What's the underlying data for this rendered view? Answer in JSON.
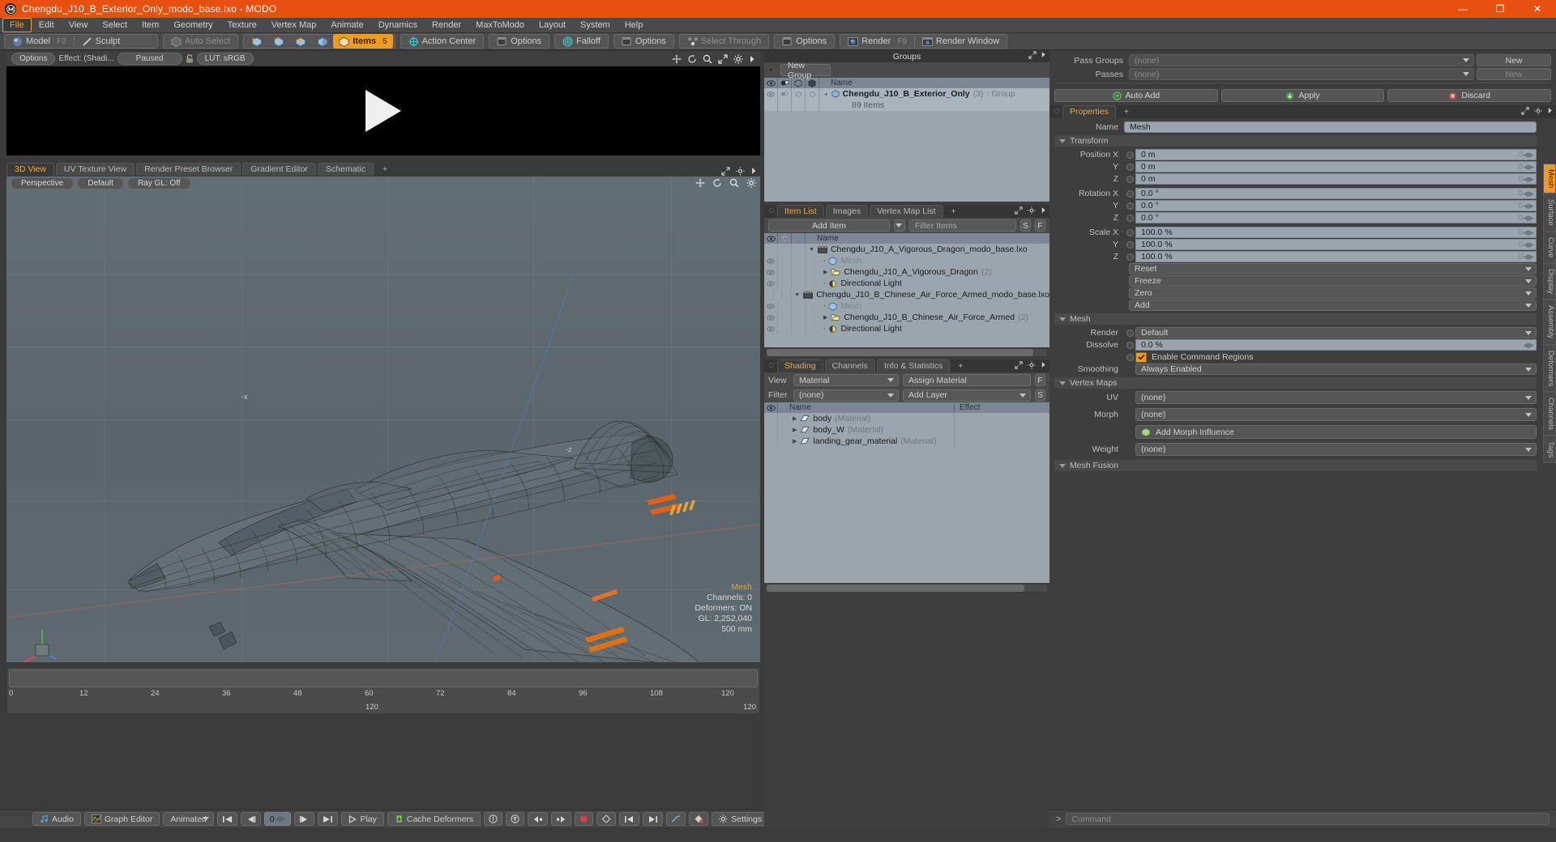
{
  "titlebar": {
    "title": "Chengdu_J10_B_Exterior_Only_modo_base.lxo - MODO",
    "minimize": "—",
    "maximize": "❐",
    "close": "✕"
  },
  "menubar": {
    "items": [
      "File",
      "Edit",
      "View",
      "Select",
      "Item",
      "Geometry",
      "Texture",
      "Vertex Map",
      "Animate",
      "Dynamics",
      "Render",
      "MaxToModo",
      "Layout",
      "System",
      "Help"
    ],
    "active": "File"
  },
  "toolbar": {
    "mode_model": "Model",
    "mode_model_key": "F2",
    "mode_sculpt": "Sculpt",
    "auto_select": "Auto Select",
    "items": "Items",
    "items_key": "5",
    "action_center": "Action Center",
    "options1": "Options",
    "falloff": "Falloff",
    "options2": "Options",
    "select_through": "Select Through",
    "options3": "Options",
    "render": "Render",
    "render_key": "F9",
    "render_window": "Render Window"
  },
  "preview": {
    "options": "Options",
    "effect": "Effect: (Shadi...",
    "paused": "Paused",
    "lut": "LUT: sRGB"
  },
  "viewport_tabs": {
    "tabs": [
      "3D View",
      "UV Texture View",
      "Render Preset Browser",
      "Gradient Editor",
      "Schematic"
    ],
    "selected": "3D View",
    "plus": "+"
  },
  "viewport": {
    "perspective": "Perspective",
    "shading": "Default",
    "raygl": "Ray GL: Off",
    "info": {
      "mesh": "Mesh",
      "channels": "Channels: 0",
      "deformers": "Deformers: ON",
      "gl": "GL: 2,252,040",
      "scale": "500 mm"
    }
  },
  "timeline": {
    "ticks": [
      "0",
      "12",
      "24",
      "36",
      "48",
      "60",
      "72",
      "84",
      "96",
      "108",
      "120"
    ],
    "center_label": "120",
    "right_label": "120"
  },
  "bottombar": {
    "audio": "Audio",
    "graph_editor": "Graph Editor",
    "animated": "Animated",
    "frame": "0",
    "play": "Play",
    "cache_deformers": "Cache Deformers",
    "settings": "Settings"
  },
  "groups": {
    "header": "Groups",
    "new_group": "New Group",
    "columns": [
      "eye",
      "shade",
      "render",
      "wire",
      "Name"
    ],
    "name_col": "Name",
    "rows": [
      {
        "name": "Chengdu_J10_B_Exterior_Only",
        "count": "(3)",
        "type": ": Group",
        "sub": "89 Items"
      }
    ]
  },
  "item_list": {
    "tabs": [
      "Item List",
      "Images",
      "Vertex Map List"
    ],
    "selected": "Item List",
    "plus": "+",
    "add_item": "Add Item",
    "filter_placeholder": "Filter Items",
    "badge_s": "S",
    "badge_f": "F",
    "name_col": "Name",
    "rows": [
      {
        "label": "Chengdu_J10_A_Vigorous_Dragon_modo_base.lxo",
        "count": "",
        "icon": "scene-icon",
        "indent": 0,
        "expanded": true,
        "dim": false
      },
      {
        "label": "Mesh",
        "count": "",
        "icon": "mesh-icon",
        "indent": 1,
        "expanded": false,
        "dim": true
      },
      {
        "label": "Chengdu_J10_A_Vigorous_Dragon",
        "count": "(2)",
        "icon": "group-icon",
        "indent": 1,
        "expanded": false,
        "dim": false
      },
      {
        "label": "Directional Light",
        "count": "",
        "icon": "light-icon",
        "indent": 1,
        "expanded": false,
        "dim": false
      },
      {
        "label": "Chengdu_J10_B_Chinese_Air_Force_Armed_modo_base.lxo",
        "count": "",
        "icon": "scene-icon",
        "indent": 0,
        "expanded": true,
        "dim": false
      },
      {
        "label": "Mesh",
        "count": "",
        "icon": "mesh-icon",
        "indent": 1,
        "expanded": false,
        "dim": true
      },
      {
        "label": "Chengdu_J10_B_Chinese_Air_Force_Armed",
        "count": "(2)",
        "icon": "group-icon",
        "indent": 1,
        "expanded": false,
        "dim": false
      },
      {
        "label": "Directional Light",
        "count": "",
        "icon": "light-icon",
        "indent": 1,
        "expanded": false,
        "dim": false
      }
    ]
  },
  "shading": {
    "tabs": [
      "Shading",
      "Channels",
      "Info & Statistics"
    ],
    "selected": "Shading",
    "plus": "+",
    "view_label": "View",
    "view_value": "Material",
    "assign_material": "Assign Material",
    "badge_f": "F",
    "filter_label": "Filter",
    "filter_value": "(none)",
    "add_layer": "Add Layer",
    "badge_s": "S",
    "name_col": "Name",
    "effect_col": "Effect",
    "rows": [
      {
        "name": "body",
        "type": "(Material)"
      },
      {
        "name": "body_W",
        "type": "(Material)"
      },
      {
        "name": "landing_gear_material",
        "type": "(Material)"
      }
    ]
  },
  "passes": {
    "pass_groups_label": "Pass Groups",
    "pass_groups_value": "(none)",
    "pass_groups_new": "New",
    "passes_label": "Passes",
    "passes_value": "(none)",
    "passes_new": "New",
    "auto_add": "Auto Add",
    "apply": "Apply",
    "discard": "Discard"
  },
  "properties": {
    "tabs": [
      "Properties"
    ],
    "selected": "Properties",
    "plus": "+",
    "name_label": "Name",
    "name_value": "Mesh",
    "transform_title": "Transform",
    "transform_rows": [
      {
        "label": "Position X",
        "value": "0 m"
      },
      {
        "label": "Y",
        "value": "0 m"
      },
      {
        "label": "Z",
        "value": "0 m"
      },
      {
        "label": "Rotation X",
        "value": "0.0 °"
      },
      {
        "label": "Y",
        "value": "0.0 °"
      },
      {
        "label": "Z",
        "value": "0.0 °"
      },
      {
        "label": "Scale X",
        "value": "100.0 %"
      },
      {
        "label": "Y",
        "value": "100.0 %"
      },
      {
        "label": "Z",
        "value": "100.0 %"
      }
    ],
    "transform_menus": [
      "Reset",
      "Freeze",
      "Zero",
      "Add"
    ],
    "mesh_title": "Mesh",
    "render_label": "Render",
    "render_value": "Default",
    "dissolve_label": "Dissolve",
    "dissolve_value": "0.0 %",
    "enable_command_regions": "Enable Command Regions",
    "smoothing_label": "Smoothing",
    "smoothing_value": "Always Enabled",
    "vertex_maps_title": "Vertex Maps",
    "uv_label": "UV",
    "uv_value": "(none)",
    "morph_label": "Morph",
    "morph_value": "(none)",
    "add_morph_influence": "Add Morph Influence",
    "weight_label": "Weight",
    "weight_value": "(none)",
    "mesh_fusion_title": "Mesh Fusion",
    "side_tabs": [
      "Mesh",
      "Surface",
      "Curve",
      "Display",
      "Assembly",
      "Deformers",
      "Channels",
      "Tags"
    ],
    "side_tab_selected": "Mesh"
  },
  "command": {
    "prompt": ">",
    "placeholder": "Command"
  },
  "colors": {
    "title_bar": "#e8500f",
    "accent": "#f09a26",
    "panel_bg": "#3e3e3e",
    "toolbar_bg": "#4a4a4a",
    "list_bg": "#9aa5ae",
    "viewport_bg": "#5e6a70"
  }
}
